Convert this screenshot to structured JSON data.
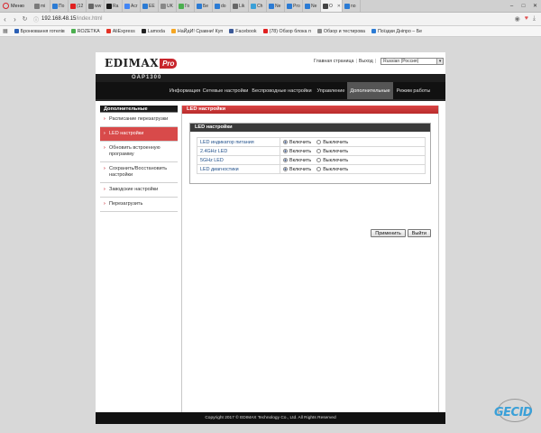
{
  "browser": {
    "menu_label": "Меню",
    "tabs": [
      {
        "label": "mi",
        "color": "#7a7a7a"
      },
      {
        "label": "По",
        "color": "#2b7bd4"
      },
      {
        "label": "(12",
        "color": "#e02020"
      },
      {
        "label": "ww",
        "color": "#666666"
      },
      {
        "label": "Ra",
        "color": "#1a1a1a"
      },
      {
        "label": "Acr",
        "color": "#4285f4"
      },
      {
        "label": "EE",
        "color": "#2b7bd4"
      },
      {
        "label": "UK",
        "color": "#888888"
      },
      {
        "label": "Го",
        "color": "#4caf50"
      },
      {
        "label": "Бе",
        "color": "#2b7bd4"
      },
      {
        "label": "do",
        "color": "#2b7bd4"
      },
      {
        "label": "Lik",
        "color": "#666666"
      },
      {
        "label": "Ch",
        "color": "#3aa0d8"
      },
      {
        "label": "Ne",
        "color": "#2b7bd4"
      },
      {
        "label": "Pro",
        "color": "#2b7bd4"
      },
      {
        "label": "Ne",
        "color": "#2b7bd4"
      },
      {
        "label": "O",
        "color": "#444444",
        "active": true
      },
      {
        "label": "no",
        "color": "#2b7bd4"
      }
    ],
    "url_main": "192.168.48.15",
    "url_path": "/index.html",
    "bookmarks": [
      {
        "label": "Бронювання готелів",
        "color": "#2b5fb4"
      },
      {
        "label": "ROZETKA",
        "color": "#4caf50"
      },
      {
        "label": "AliExpress",
        "color": "#e43225"
      },
      {
        "label": "Lamoda",
        "color": "#222222"
      },
      {
        "label": "НаЙдИ! Сравни! Куп",
        "color": "#f5a623"
      },
      {
        "label": "Facebook",
        "color": "#3b5998"
      },
      {
        "label": "(78) Обзор блока п",
        "color": "#e02020"
      },
      {
        "label": "Обзор и тестирова",
        "color": "#888888"
      },
      {
        "label": "Поїздки Дніпро – Бе",
        "color": "#2b7bd4"
      }
    ]
  },
  "router": {
    "brand": "EDIMAX",
    "brand_suffix": "Pro",
    "header_links": {
      "home": "Главная страница",
      "logout": "Выход",
      "language": "Russian (Россия)"
    },
    "model": "OAP1300",
    "nav": [
      {
        "label": "Информация"
      },
      {
        "label": "Сетевые настройки"
      },
      {
        "label": "Беспроводные настройки"
      },
      {
        "label": "Управление"
      },
      {
        "label": "Дополнительные",
        "active": true
      },
      {
        "label": "Режим работы"
      }
    ],
    "sidebar": {
      "title": "Дополнительные",
      "items": [
        {
          "label": "Расписание перезагрузки"
        },
        {
          "label": "LED настройки",
          "active": true
        },
        {
          "label": "Обновить встроенную программу"
        },
        {
          "label": "Сохранить/Восстановить настройки"
        },
        {
          "label": "Заводские настройки"
        },
        {
          "label": "Перезагрузить"
        }
      ]
    },
    "main": {
      "title": "LED настройки",
      "box_title": "LED настройки",
      "option_on": "Включить",
      "option_off": "Выключить",
      "rows": [
        {
          "label": "LED индикатор питания",
          "selected": "on"
        },
        {
          "label": "2.4GHz LED",
          "selected": "on"
        },
        {
          "label": "5GHz LED",
          "selected": "on"
        },
        {
          "label": "LED диагностики",
          "selected": "on"
        }
      ],
      "apply_label": "Применить",
      "exit_label": "Выйти"
    },
    "footer": "Copyright 2017 © EDIMAX Technology Co., Ltd. All Rights Reserved",
    "colors": {
      "accent": "#c8252c",
      "nav_bg": "#111111",
      "active_sidebar": "#d84a4a"
    }
  },
  "watermark": {
    "text": "GECID"
  }
}
